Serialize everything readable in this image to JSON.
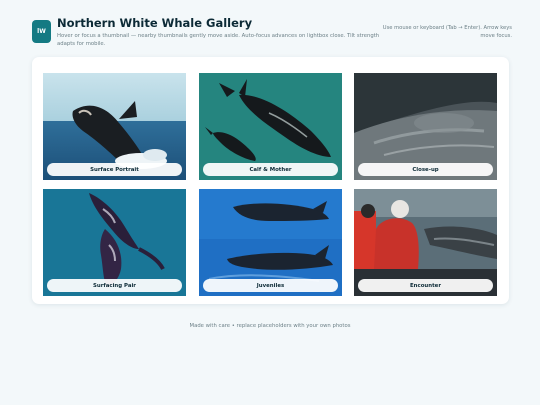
{
  "header": {
    "logo_text": "lW",
    "title": "Northern White Whale Gallery",
    "subtitle": "Hover or focus a thumbnail — nearby thumbnails gently move aside. Auto-focus advances on lightbox close. Tilt strength adapts for mobile.",
    "hint": "Use mouse or keyboard (Tab → Enter). Arrow keys move focus."
  },
  "gallery": {
    "items": [
      {
        "caption": "Surface Portrait"
      },
      {
        "caption": "Calf & Mother"
      },
      {
        "caption": "Close-up"
      },
      {
        "caption": "Surfacing Pair"
      },
      {
        "caption": "Juveniles"
      },
      {
        "caption": "Encounter"
      }
    ]
  },
  "footer": {
    "text": "Made with care • replace placeholders with your own photos"
  },
  "colors": {
    "accent": "#147a83",
    "background": "#f3f8fa"
  }
}
